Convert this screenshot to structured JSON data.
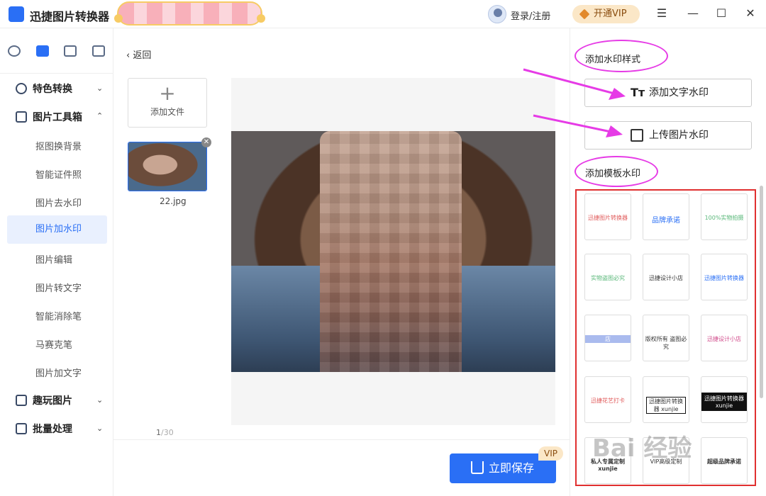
{
  "app": {
    "title": "迅捷图片转换器",
    "login": "登录/注册",
    "vip_button": "开通VIP"
  },
  "window_controls": {
    "menu": "☰",
    "minimize": "—",
    "maximize": "☐",
    "close": "✕"
  },
  "sidebar": {
    "groups": [
      {
        "label": "特色转换",
        "icon": "exchange-icon",
        "expanded": false
      },
      {
        "label": "图片工具箱",
        "icon": "toolbox-icon",
        "expanded": true
      },
      {
        "label": "趣玩图片",
        "icon": "image-icon",
        "expanded": false
      },
      {
        "label": "批量处理",
        "icon": "batch-icon",
        "expanded": false
      }
    ],
    "items": [
      "抠图换背景",
      "智能证件照",
      "图片去水印",
      "图片加水印",
      "图片编辑",
      "图片转文字",
      "智能消除笔",
      "马赛克笔",
      "图片加文字"
    ],
    "active_item": "图片加水印"
  },
  "main": {
    "back": "返回",
    "add_file": "添加文件",
    "file_name": "22.jpg",
    "page_current": "1",
    "page_total": "/30",
    "save_button": "立即保存",
    "vip_tag": "VIP"
  },
  "right": {
    "style_title": "添加水印样式",
    "text_watermark": "添加文字水印",
    "image_watermark": "上传图片水印",
    "template_title": "添加模板水印",
    "templates": [
      "迅捷图片转换器",
      "品牌承诺",
      "100%实物拍摄",
      "实物盗图必究",
      "迅捷设计小店",
      "迅捷图片转换器",
      "店",
      "版权所有 盗图必究",
      "迅捷设计小店",
      "迅捷花艺打卡",
      "迅捷图片转换器 xunjie",
      "迅捷图片转换器 xunjie",
      "私人专属定制 xunjie",
      "VIP高级定制",
      "超级品牌承诺"
    ],
    "site_watermark": "Bai 经验"
  },
  "colors": {
    "accent": "#2a6ff5",
    "annotation": "#e63be6",
    "highlight_box": "#e03030",
    "vip_bg": "#fbe7c7"
  }
}
